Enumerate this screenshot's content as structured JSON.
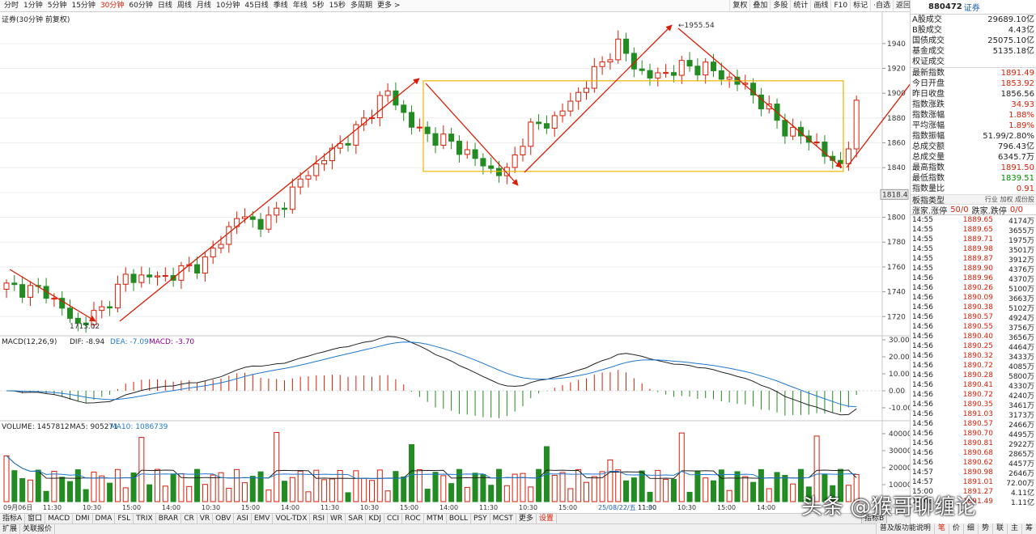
{
  "toolbar": {
    "periods": [
      "分时",
      "1分钟",
      "5分钟",
      "15分钟",
      "30分钟",
      "60分钟",
      "日线",
      "周线",
      "月线",
      "10分钟",
      "45日线",
      "季线",
      "年线",
      "5秒",
      "15秒",
      "多周期"
    ],
    "active_period": "30分钟",
    "more": "更多 >",
    "tools": [
      "复权",
      "叠加",
      "多股",
      "统计",
      "画线",
      "F10",
      "标记",
      "·自选",
      "返回"
    ]
  },
  "stock": {
    "code": "880472",
    "name": "证券"
  },
  "chart_title": "证券(30分钟 前复权)",
  "main_chart": {
    "price_labels": [
      "1940",
      "1920",
      "1900",
      "1880",
      "1860",
      "1840",
      "1820",
      "1800",
      "1780",
      "1760",
      "1740",
      "1720"
    ],
    "high_label": "1955.54",
    "low_label": "1713.02",
    "current_price_tag": "1818.4"
  },
  "macd": {
    "legend": "MACD(12,26,9)",
    "dif": "DIF: -8.94",
    "dea": "DEA: -7.09",
    "macd": "MACD: -3.70",
    "axis": [
      "30.00",
      "20.00",
      "10.00",
      "0.00",
      "-10.00"
    ]
  },
  "volume": {
    "legend": "VOLUME: 1457812",
    "ma5": "MA5: 905271",
    "ma10": "MA10: 1086739",
    "axis": [
      "40000",
      "30000",
      "20000",
      "10000"
    ]
  },
  "time_axis": [
    "09月06日",
    "11:30",
    "10:30",
    "15:00",
    "14:00",
    "10:30",
    "15:00",
    "14:00",
    "11:30",
    "10:30",
    "15:00",
    "14:00",
    "11:30",
    "10:30",
    "15:00",
    "25/08/22/五 11:00",
    "11:30",
    "10:30",
    "15:00",
    "14:00"
  ],
  "colors": {
    "up": "#d81e06",
    "down": "#228b22",
    "trend": "#d81e06",
    "box": "#f0b400",
    "dif": "#222222",
    "dea": "#1f78d1",
    "ma5": "#222222",
    "ma10": "#1f78d1"
  },
  "stats": [
    {
      "label": "A股成交",
      "value": "29689.10亿",
      "tone": "blk"
    },
    {
      "label": "B股成交",
      "value": "4.43亿",
      "tone": "blk"
    },
    {
      "label": "国债成交",
      "value": "25075.10亿",
      "tone": "blk"
    },
    {
      "label": "基金成交",
      "value": "5135.18亿",
      "tone": "blk"
    },
    {
      "label": "权证成交",
      "value": "",
      "tone": "blk"
    }
  ],
  "quote": [
    {
      "label": "最新指数",
      "value": "1891.49",
      "tone": "red"
    },
    {
      "label": "今日开盘",
      "value": "1853.92",
      "tone": "red"
    },
    {
      "label": "昨日收盘",
      "value": "1856.56",
      "tone": "blk"
    },
    {
      "label": "指数涨跌",
      "value": "34.93",
      "tone": "red"
    },
    {
      "label": "指数涨幅",
      "value": "1.88%",
      "tone": "red"
    },
    {
      "label": "平均涨幅",
      "value": "1.89%",
      "tone": "red"
    },
    {
      "label": "指数振幅",
      "value": "51.99/2.80%",
      "tone": "blk"
    },
    {
      "label": "总成交额",
      "value": "796.43亿",
      "tone": "blk"
    },
    {
      "label": "总成交量",
      "value": "6345.7万",
      "tone": "blk"
    },
    {
      "label": "最高指数",
      "value": "1891.50",
      "tone": "red"
    },
    {
      "label": "最低指数",
      "value": "1839.51",
      "tone": "green"
    },
    {
      "label": "指数量比",
      "value": "0.91",
      "tone": "red"
    }
  ],
  "category": {
    "label": "板指类型",
    "tags": "行业 加权 成份股"
  },
  "updown": {
    "up_label": "涨家.涨停",
    "up_value": "50/0",
    "down_label": "跌家.跌停",
    "down_value": "0/0"
  },
  "ticks": [
    {
      "t": "14:55",
      "p": "1889.65",
      "v": "4174万"
    },
    {
      "t": "14:55",
      "p": "1889.65",
      "v": "3655万"
    },
    {
      "t": "14:55",
      "p": "1889.71",
      "v": "1975万"
    },
    {
      "t": "14:55",
      "p": "1889.98",
      "v": "3501万"
    },
    {
      "t": "14:55",
      "p": "1889.87",
      "v": "3912万"
    },
    {
      "t": "14:55",
      "p": "1889.90",
      "v": "4376万"
    },
    {
      "t": "14:56",
      "p": "1889.96",
      "v": "4370万"
    },
    {
      "t": "14:56",
      "p": "1890.26",
      "v": "5100万"
    },
    {
      "t": "14:56",
      "p": "1890.09",
      "v": "3663万"
    },
    {
      "t": "14:56",
      "p": "1890.38",
      "v": "5102万"
    },
    {
      "t": "14:56",
      "p": "1890.57",
      "v": "4924万"
    },
    {
      "t": "14:56",
      "p": "1890.55",
      "v": "3756万"
    },
    {
      "t": "14:56",
      "p": "1890.40",
      "v": "3656万"
    },
    {
      "t": "14:56",
      "p": "1890.25",
      "v": "4464万"
    },
    {
      "t": "14:56",
      "p": "1890.32",
      "v": "3433万"
    },
    {
      "t": "14:56",
      "p": "1890.72",
      "v": "4085万"
    },
    {
      "t": "14:56",
      "p": "1890.28",
      "v": "5800万"
    },
    {
      "t": "14:56",
      "p": "1890.41",
      "v": "4330万"
    },
    {
      "t": "14:56",
      "p": "1890.72",
      "v": "4240万"
    },
    {
      "t": "14:56",
      "p": "1890.35",
      "v": "3461万"
    },
    {
      "t": "14:56",
      "p": "1891.03",
      "v": "3173万"
    },
    {
      "t": "14:56",
      "p": "1890.57",
      "v": "2466万"
    },
    {
      "t": "14:56",
      "p": "1890.70",
      "v": "4495万"
    },
    {
      "t": "14:56",
      "p": "1890.81",
      "v": "2922万"
    },
    {
      "t": "14:56",
      "p": "1890.68",
      "v": "2865万"
    },
    {
      "t": "14:56",
      "p": "1890.62",
      "v": "4457万"
    },
    {
      "t": "14:57",
      "p": "1890.98",
      "v": "2646万"
    },
    {
      "t": "14:57",
      "p": "1891.01",
      "v": "72.00万"
    },
    {
      "t": "15:00",
      "p": "1891.27",
      "v": "4.11亿"
    },
    {
      "t": "15:00",
      "p": "1891.49",
      "v": "1.11亿"
    }
  ],
  "bottom_tabs": [
    "指标A",
    "窗口",
    "MACD",
    "DMI",
    "DMA",
    "FSL",
    "TRIX",
    "BRAR",
    "CR",
    "VR",
    "OBV",
    "ASI",
    "EMV",
    "VOL-TDX",
    "RSI",
    "WR",
    "SAR",
    "KDJ",
    "CCI",
    "ROC",
    "MTM",
    "BOLL",
    "PSY",
    "MCST",
    "更多",
    "设置"
  ],
  "bottom_tabs2": [
    "扩展",
    "关联报价"
  ],
  "index_button": "指标B",
  "bottom_right": [
    "普及版功能说明",
    "笔",
    "价",
    "细",
    "势",
    "联",
    "主",
    "筹"
  ],
  "watermark": "头条 @猴哥聊缠论"
}
